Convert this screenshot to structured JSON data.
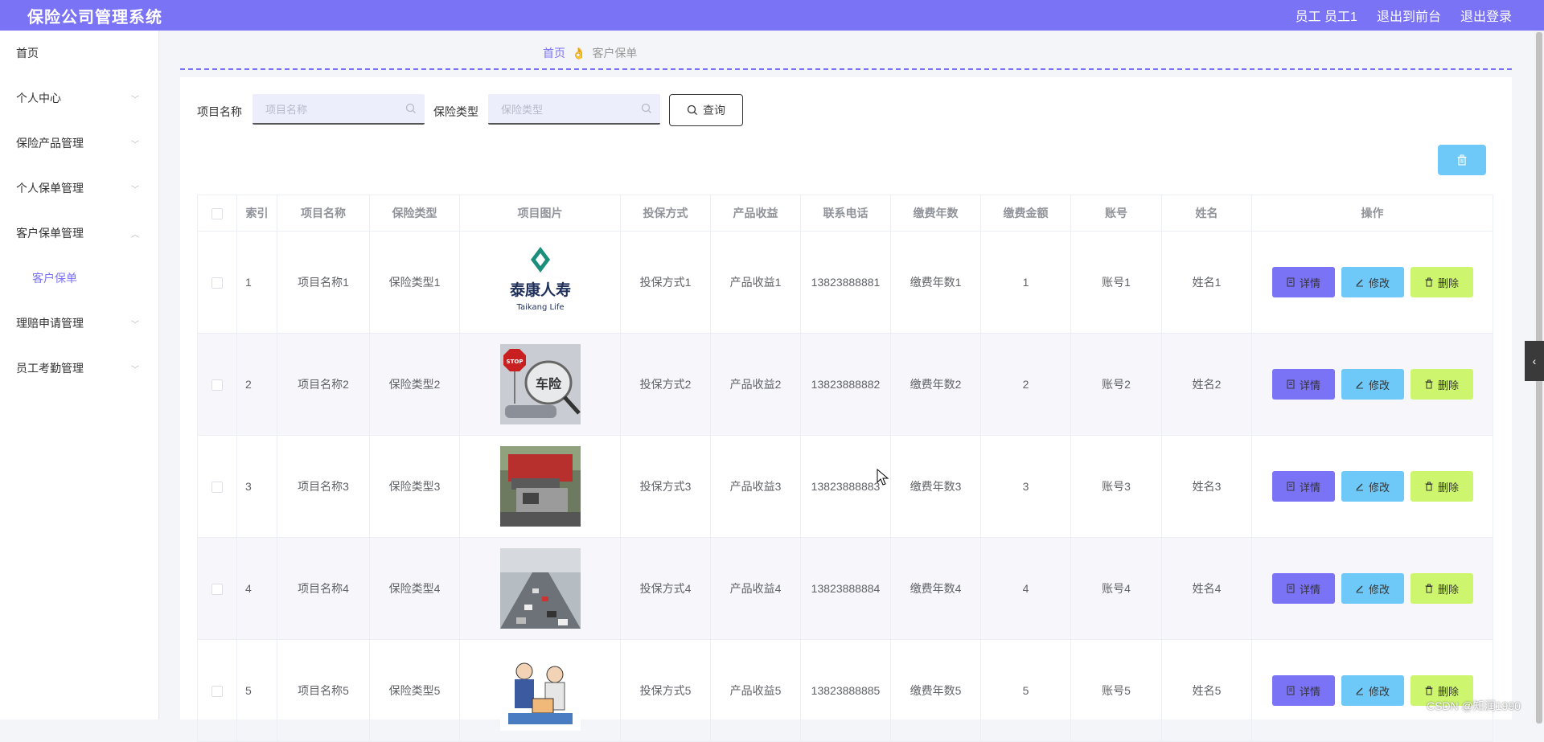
{
  "header": {
    "title": "保险公司管理系统",
    "user_label": "员工 员工1",
    "to_front": "退出到前台",
    "logout": "退出登录"
  },
  "sidebar": {
    "items": [
      {
        "label": "首页",
        "expandable": false
      },
      {
        "label": "个人中心",
        "expandable": true
      },
      {
        "label": "保险产品管理",
        "expandable": true
      },
      {
        "label": "个人保单管理",
        "expandable": true
      },
      {
        "label": "客户保单管理",
        "expandable": true,
        "expanded": true
      },
      {
        "label": "客户保单",
        "sub": true,
        "active": true
      },
      {
        "label": "理赔申请管理",
        "expandable": true
      },
      {
        "label": "员工考勤管理",
        "expandable": true
      }
    ]
  },
  "breadcrumb": {
    "home": "首页",
    "separator": "👌",
    "current": "客户保单"
  },
  "search": {
    "field1_label": "项目名称",
    "field1_placeholder": "项目名称",
    "field2_label": "保险类型",
    "field2_placeholder": "保险类型",
    "query_button": "查询"
  },
  "table": {
    "columns": [
      "索引",
      "项目名称",
      "保险类型",
      "项目图片",
      "投保方式",
      "产品收益",
      "联系电话",
      "缴费年数",
      "缴费金额",
      "账号",
      "姓名",
      "操作"
    ],
    "rows": [
      {
        "index": "1",
        "name": "项目名称1",
        "type": "保险类型1",
        "image": "taikang-life-logo",
        "method": "投保方式1",
        "revenue": "产品收益1",
        "phone": "13823888881",
        "years": "缴费年数1",
        "amount": "1",
        "account": "账号1",
        "person": "姓名1"
      },
      {
        "index": "2",
        "name": "项目名称2",
        "type": "保险类型2",
        "image": "car-insurance-photo",
        "method": "投保方式2",
        "revenue": "产品收益2",
        "phone": "13823888882",
        "years": "缴费年数2",
        "amount": "2",
        "account": "账号2",
        "person": "姓名2"
      },
      {
        "index": "3",
        "name": "项目名称3",
        "type": "保险类型3",
        "image": "truck-crash-photo",
        "method": "投保方式3",
        "revenue": "产品收益3",
        "phone": "13823888883",
        "years": "缴费年数3",
        "amount": "3",
        "account": "账号3",
        "person": "姓名3"
      },
      {
        "index": "4",
        "name": "项目名称4",
        "type": "保险类型4",
        "image": "highway-traffic-photo",
        "method": "投保方式4",
        "revenue": "产品收益4",
        "phone": "13823888884",
        "years": "缴费年数4",
        "amount": "4",
        "account": "账号4",
        "person": "姓名4"
      },
      {
        "index": "5",
        "name": "项目名称5",
        "type": "保险类型5",
        "image": "claims-illustration",
        "method": "投保方式5",
        "revenue": "产品收益5",
        "phone": "13823888885",
        "years": "缴费年数5",
        "amount": "5",
        "account": "账号5",
        "person": "姓名5"
      }
    ],
    "actions": {
      "detail": "详情",
      "edit": "修改",
      "delete": "删除"
    }
  },
  "logo_text": {
    "cn": "泰康人寿",
    "en": "Taikang Life"
  },
  "photo_text": {
    "stop": "STOP",
    "chexian": "车险"
  },
  "watermark": "CSDN @知润1990",
  "colors": {
    "primary": "#7b73f5",
    "edit": "#6ec8f8",
    "delete": "#cdf56e"
  }
}
